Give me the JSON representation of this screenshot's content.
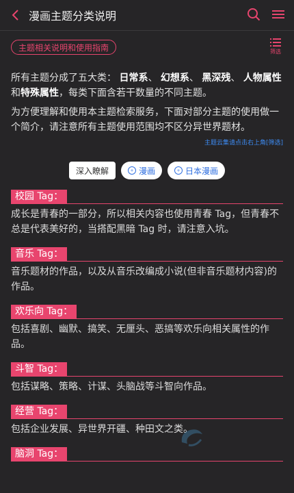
{
  "header": {
    "back_glyph": "<",
    "title": "漫画主题分类说明",
    "search_icon": "search-icon",
    "menu_icon": "menu-icon"
  },
  "guide_chip": "主题相关说明和使用指南",
  "filter": {
    "label": "筛选",
    "icon": "filter-list-icon"
  },
  "intro": {
    "p1_before": "所有主题分成了五大类：",
    "cat1": "日常系",
    "sep1": "、",
    "cat2": "幻想系",
    "sep2": "、",
    "cat3": "黑深残",
    "sep3": "、",
    "cat4": "人物属性",
    "and": "和",
    "cat5": "特殊属性",
    "p1_after": "，每类下面含若干数量的不同主题。",
    "p2": "为方便理解和使用本主题检索服务，下面对部分主题的使用做一个简介，请注意所有主题使用范围均不区分异世界题材。",
    "cloud_note": "主题云集请点击右上角[筛选]"
  },
  "buttons": {
    "deep": "深入瞭解",
    "manga": "漫画",
    "jp_manga": "日本漫画"
  },
  "sections": [
    {
      "tag": "校园 Tag：",
      "desc": "成长是青春的一部分，所以相关内容也使用青春 Tag，但青春不总是代表美好的，当搭配黑暗 Tag 时，请注意入坑。"
    },
    {
      "tag": "音乐 Tag：",
      "desc": "音乐题材的作品，以及从音乐改编成小说(但非音乐题材内容)的作品。"
    },
    {
      "tag": "欢乐向 Tag：",
      "desc": "包括喜剧、幽默、搞笑、无厘头、恶搞等欢乐向相关属性的作品。"
    },
    {
      "tag": "斗智 Tag：",
      "desc": "包括谋略、策略、计谋、头脑战等斗智向作品。"
    },
    {
      "tag": "经营 Tag：",
      "desc": "包括企业发展、异世界开疆、种田文之类。"
    },
    {
      "tag": "脑洞 Tag：",
      "desc": ""
    }
  ],
  "colors": {
    "accent": "#e8456e",
    "background": "#262527",
    "link": "#3d8bf3"
  }
}
